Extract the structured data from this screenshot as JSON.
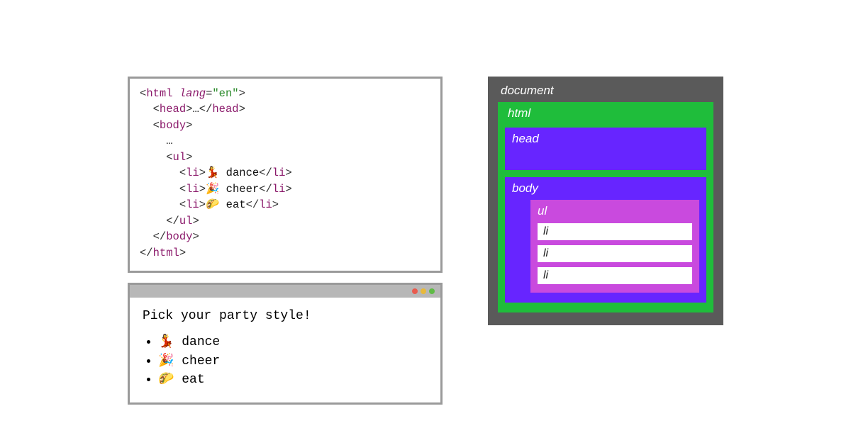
{
  "code": {
    "lang_attr": "lang",
    "lang_val": "\"en\"",
    "tag_html": "html",
    "tag_head": "head",
    "tag_body": "body",
    "tag_ul": "ul",
    "tag_li": "li",
    "ellipsis": "…",
    "li_items": [
      {
        "emoji": "💃",
        "text": " dance"
      },
      {
        "emoji": "🎉",
        "text": " cheer"
      },
      {
        "emoji": "🌮",
        "text": " eat"
      }
    ]
  },
  "browser": {
    "heading": "Pick your party style!",
    "items": [
      {
        "emoji": "💃",
        "text": " dance"
      },
      {
        "emoji": "🎉",
        "text": " cheer"
      },
      {
        "emoji": "🌮",
        "text": " eat"
      }
    ]
  },
  "dom": {
    "document": "document",
    "html": "html",
    "head": "head",
    "body": "body",
    "ul": "ul",
    "li": "li"
  }
}
